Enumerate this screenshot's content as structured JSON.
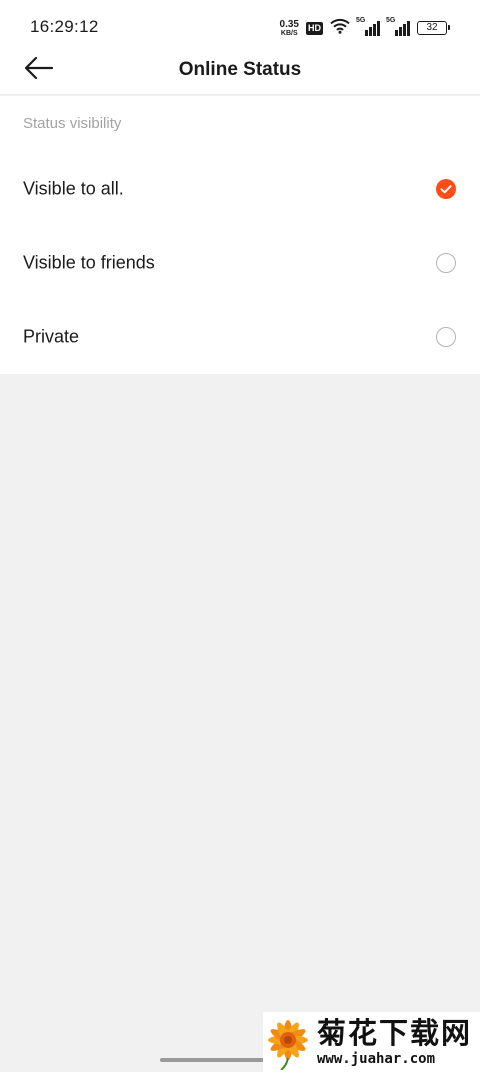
{
  "status_bar": {
    "time": "16:29:12",
    "net_speed_value": "0.35",
    "net_speed_unit": "KB/S",
    "hd_label": "HD",
    "signal_1_label": "5G",
    "signal_2_label": "5G",
    "battery_level": "32",
    "icons": [
      "hd-icon",
      "wifi-icon",
      "signal-5g-icon",
      "signal-5g-icon",
      "battery-icon"
    ]
  },
  "header": {
    "title": "Online Status",
    "back_icon": "arrow-left-icon"
  },
  "settings": {
    "section_label": "Status visibility",
    "selected_index": 0,
    "options": [
      {
        "label": "Visible to all.",
        "selected": true
      },
      {
        "label": "Visible to friends",
        "selected": false
      },
      {
        "label": "Private",
        "selected": false
      }
    ]
  },
  "colors": {
    "accent": "#ff4d1a",
    "background": "#f1f1f1",
    "card": "#ffffff",
    "section_label": "#a3a3a3"
  },
  "watermark": {
    "text": "菊花下载网",
    "url": "www.juahar.com"
  }
}
